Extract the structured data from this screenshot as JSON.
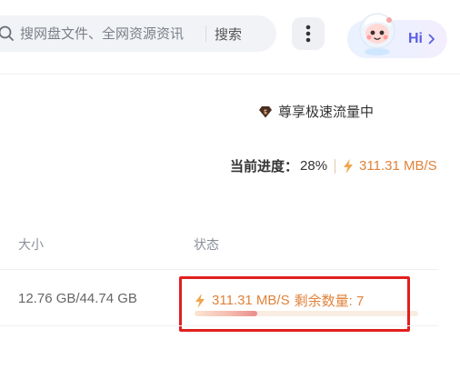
{
  "search": {
    "placeholder": "搜网盘文件、全网资源资讯",
    "button_label": "搜索"
  },
  "assistant": {
    "label": "Hi"
  },
  "vip": {
    "text": "尊享极速流量中"
  },
  "progress": {
    "label": "当前进度：",
    "value": "28%",
    "speed": "311.31 MB/S"
  },
  "table": {
    "columns": [
      "大小",
      "状态"
    ],
    "rows": [
      {
        "size": "12.76 GB/44.74 GB",
        "status_speed": "311.31 MB/S",
        "status_remaining": "剩余数量: 7",
        "status_fraction": 0.28
      }
    ]
  },
  "colors": {
    "accent_orange": "#e0823a",
    "highlight_red": "#e0201e",
    "assistant_blue": "#5a5fe0"
  }
}
